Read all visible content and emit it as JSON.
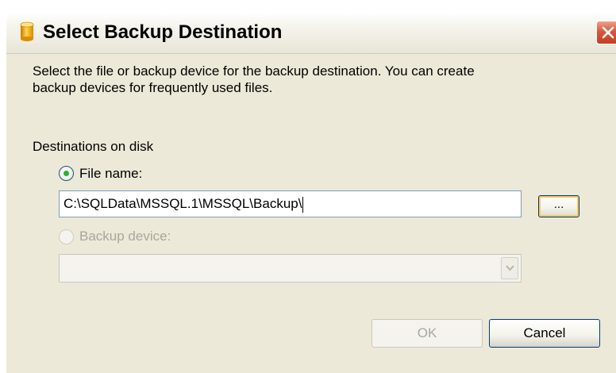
{
  "window": {
    "title": "Select Backup Destination"
  },
  "description": {
    "line1": "Select the file or backup device for the backup destination. You can create",
    "line2": "backup devices for frequently used files."
  },
  "destinations": {
    "group_label": "Destinations on disk",
    "file_name": {
      "label": "File name:",
      "selected": true,
      "value": "C:\\SQLData\\MSSQL.1\\MSSQL\\Backup\\"
    },
    "browse_label": "...",
    "backup_device": {
      "label": "Backup device:",
      "selected": false,
      "enabled": false,
      "value": ""
    }
  },
  "buttons": {
    "ok": "OK",
    "cancel": "Cancel"
  },
  "icons": {
    "title": "database-cylinder-icon",
    "close": "close-icon",
    "dropdown": "chevron-down-icon"
  },
  "colors": {
    "dialog_bg": "#ece9d8",
    "close_button": "#d8573c",
    "radio_selected_dot": "#2fb12f",
    "disabled_text": "#a9a79c",
    "default_button_focus": "#f8c85a"
  }
}
